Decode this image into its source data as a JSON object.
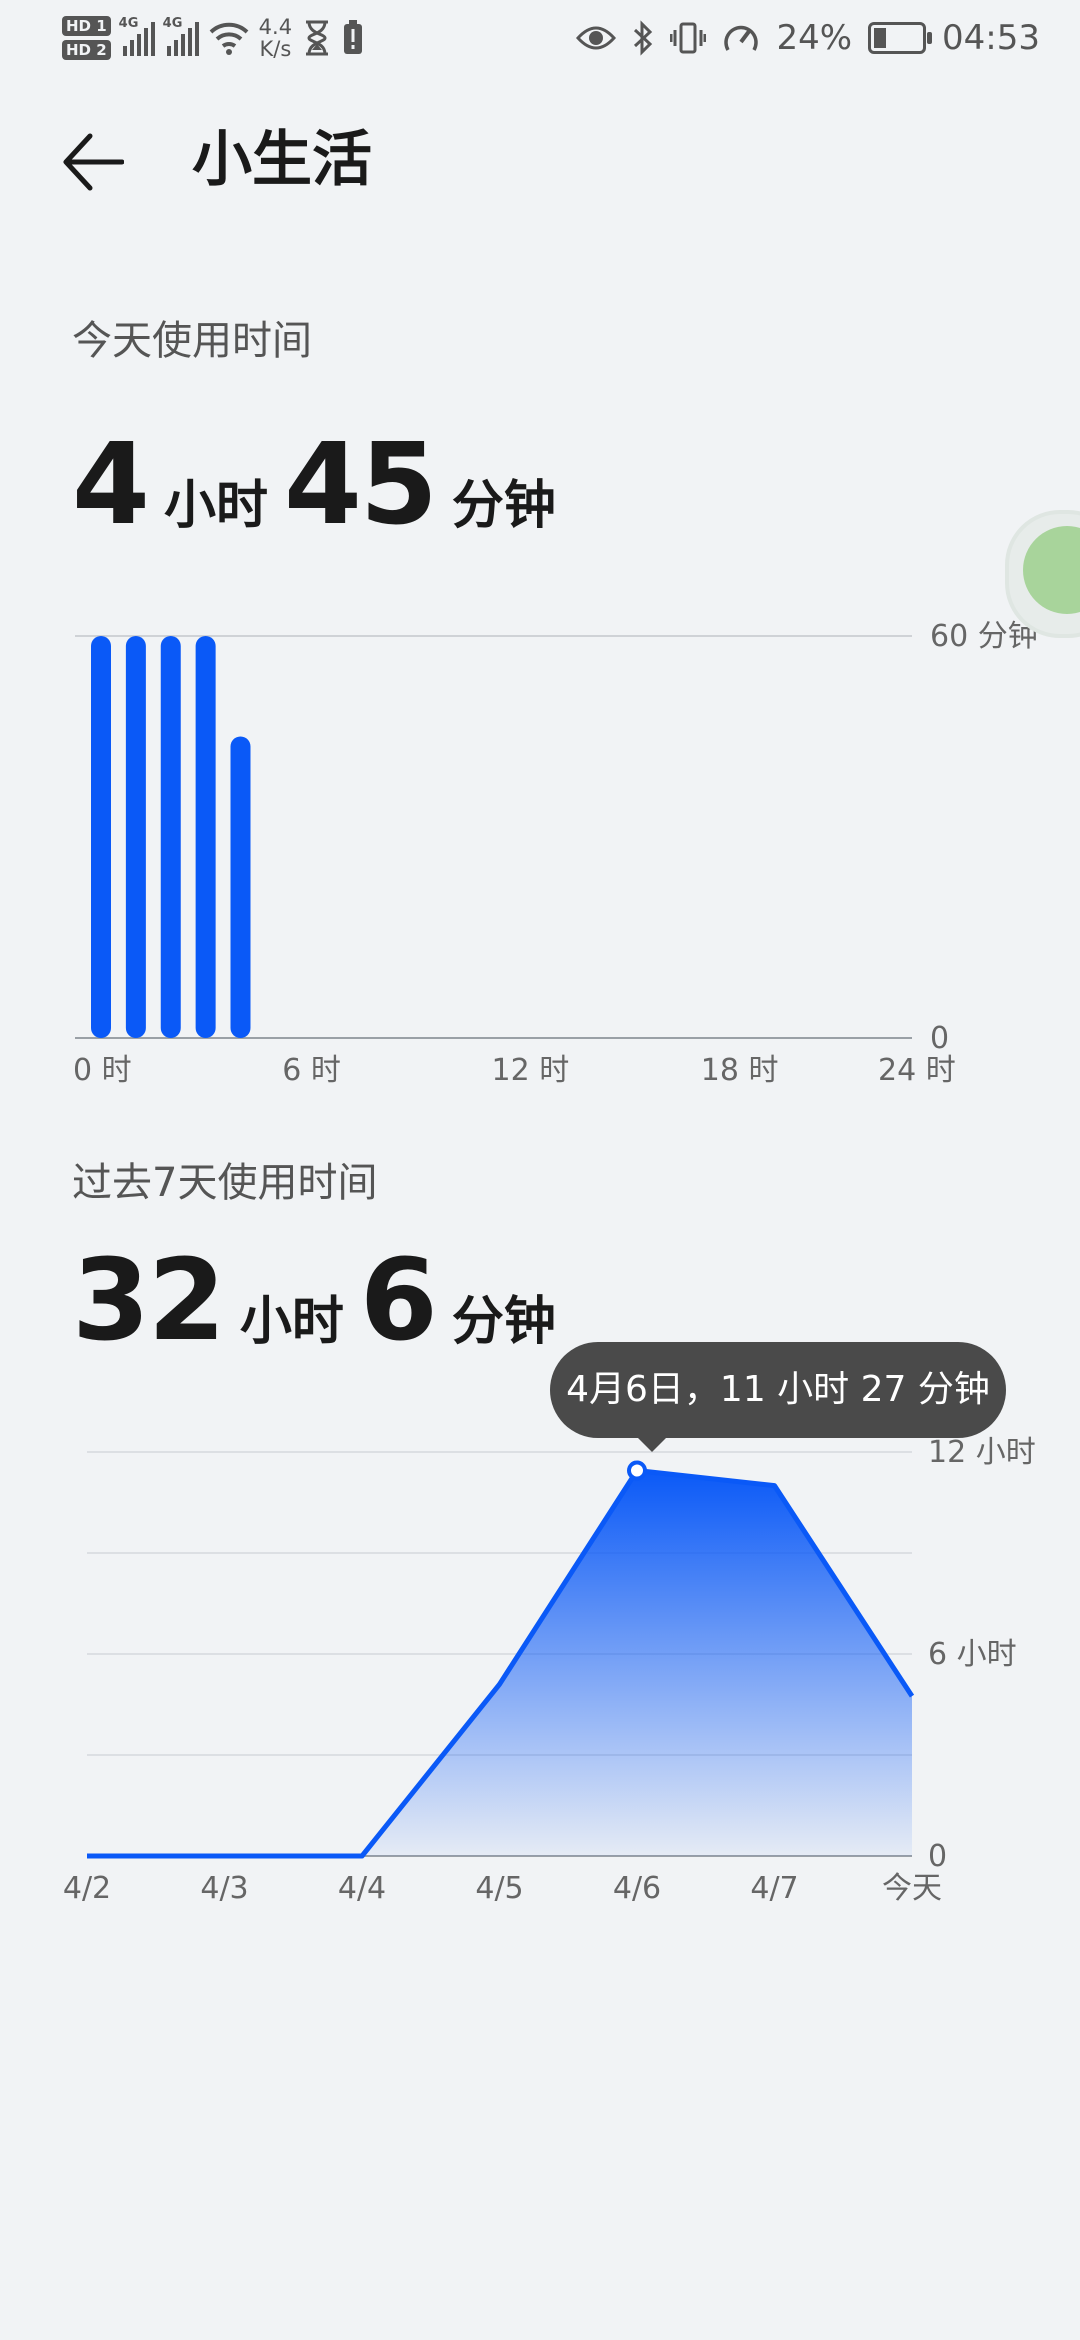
{
  "status_bar": {
    "hd1": "HD 1",
    "hd2": "HD 2",
    "sig1_label": "4G",
    "sig2_label": "4G",
    "net_speed_value": "4.4",
    "net_speed_unit": "K/s",
    "battery_percent": "24%",
    "clock": "04:53",
    "icons": [
      "eye-icon",
      "bluetooth-icon",
      "vibrate-icon",
      "speedometer-icon",
      "battery-icon",
      "hourglass-icon",
      "alert-battery-icon",
      "wifi-icon"
    ]
  },
  "header": {
    "title": "小生活",
    "back_icon": "back-arrow-icon"
  },
  "today": {
    "label": "今天使用时间",
    "hours": "4",
    "hours_unit": "小时",
    "minutes": "45",
    "minutes_unit": "分钟"
  },
  "week": {
    "label": "过去7天使用时间",
    "hours": "32",
    "hours_unit": "小时",
    "minutes": "6",
    "minutes_unit": "分钟"
  },
  "tooltip": {
    "text": "4月6日，11 小时 27 分钟"
  },
  "colors": {
    "accent": "#0a59f7",
    "background": "#f1f3f5",
    "tooltip_bg": "#4a4a4a"
  },
  "chart_data": [
    {
      "type": "bar",
      "title": "",
      "x_unit": "时",
      "x_ticks": [
        "0 时",
        "6 时",
        "12 时",
        "18 时",
        "24 时"
      ],
      "y_ticks": [
        "0",
        "60 分钟"
      ],
      "ylim": [
        0,
        60
      ],
      "categories": [
        0,
        1,
        2,
        3,
        4,
        5,
        6,
        7,
        8,
        9,
        10,
        11,
        12,
        13,
        14,
        15,
        16,
        17,
        18,
        19,
        20,
        21,
        22,
        23
      ],
      "values": [
        60,
        60,
        60,
        60,
        45,
        0,
        0,
        0,
        0,
        0,
        0,
        0,
        0,
        0,
        0,
        0,
        0,
        0,
        0,
        0,
        0,
        0,
        0,
        0
      ],
      "grid": true
    },
    {
      "type": "area",
      "title": "",
      "categories": [
        "4/2",
        "4/3",
        "4/4",
        "4/5",
        "4/6",
        "4/7",
        "今天"
      ],
      "values": [
        0,
        0,
        0,
        5.1,
        11.45,
        11.0,
        4.75
      ],
      "y_ticks": [
        "0",
        "6 小时",
        "12 小时"
      ],
      "ylim": [
        0,
        12
      ],
      "grid": true,
      "highlight_index": 4
    }
  ]
}
